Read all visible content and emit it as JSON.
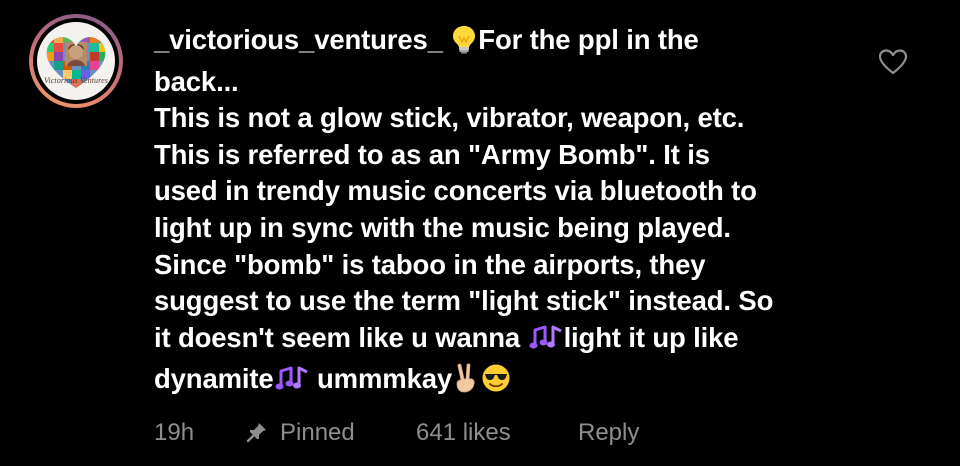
{
  "comment": {
    "avatar": {
      "text": "Victorious Ventures",
      "icon": "heart-collage-avatar"
    },
    "username": "_victorious_ventures_",
    "lines": [
      "For the ppl in the",
      "back...",
      "This is not a glow stick, vibrator, weapon, etc.",
      "This is referred to as an \"Army Bomb\". It is",
      "used in trendy music concerts via bluetooth to",
      "light up in sync with the music being played.",
      "Since \"bomb\" is taboo in the airports, they",
      "suggest to use the term \"light stick\" instead. So",
      "it doesn't seem like u wanna ",
      "light it up like",
      "dynamite",
      " ummmkay"
    ],
    "emojis": {
      "bulb": "light-bulb-icon",
      "notes": "musical-notes-icon",
      "victory": "victory-hand-icon",
      "sunglasses": "sunglasses-face-icon"
    },
    "like_icon": "heart-outline-icon",
    "footer": {
      "time": "19h",
      "pinned": "Pinned",
      "pin_icon": "pin-icon",
      "likes": "641 likes",
      "reply": "Reply"
    }
  },
  "colors": {
    "background": "#000000",
    "text": "#ffffff",
    "muted": "#8e8e8e"
  }
}
